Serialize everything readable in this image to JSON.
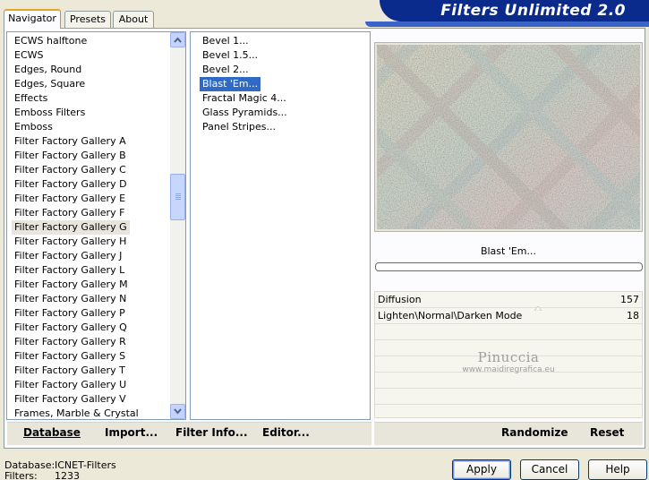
{
  "banner": {
    "title": "Filters Unlimited 2.0"
  },
  "tabs": [
    {
      "label": "Navigator",
      "active": true
    },
    {
      "label": "Presets",
      "active": false
    },
    {
      "label": "About",
      "active": false
    }
  ],
  "categories": {
    "items": [
      "ECWS halftone",
      "ECWS",
      "Edges, Round",
      "Edges, Square",
      "Effects",
      "Emboss Filters",
      "Emboss",
      "Filter Factory Gallery A",
      "Filter Factory Gallery B",
      "Filter Factory Gallery C",
      "Filter Factory Gallery D",
      "Filter Factory Gallery E",
      "Filter Factory Gallery F",
      "Filter Factory Gallery G",
      "Filter Factory Gallery H",
      "Filter Factory Gallery J",
      "Filter Factory Gallery L",
      "Filter Factory Gallery M",
      "Filter Factory Gallery N",
      "Filter Factory Gallery P",
      "Filter Factory Gallery Q",
      "Filter Factory Gallery R",
      "Filter Factory Gallery S",
      "Filter Factory Gallery T",
      "Filter Factory Gallery U",
      "Filter Factory Gallery V",
      "Frames, Marble & Crystal"
    ],
    "selected_index": 13
  },
  "filters": {
    "items": [
      "Bevel 1...",
      "Bevel 1.5...",
      "Bevel 2...",
      "Blast 'Em...",
      "Fractal Magic 4...",
      "Glass Pyramids...",
      "Panel Stripes..."
    ],
    "selected_index": 3
  },
  "preview": {
    "filter_name": "Blast 'Em...",
    "progress": 0
  },
  "params": [
    {
      "name": "Diffusion",
      "value": "157"
    },
    {
      "name": "Lighten\\Normal\\Darken Mode",
      "value": "18"
    }
  ],
  "watermark": {
    "name": "Pinuccia",
    "url": "www.maidiregrafica.eu"
  },
  "actions": {
    "database": "Database",
    "import": "Import...",
    "filter_info": "Filter Info...",
    "editor": "Editor...",
    "randomize": "Randomize",
    "reset": "Reset"
  },
  "status": {
    "database_label": "Database:",
    "database_value": "ICNET-Filters",
    "filters_label": "Filters:",
    "filters_value": "1233"
  },
  "dialog": {
    "apply": "Apply",
    "cancel": "Cancel",
    "help": "Help"
  },
  "colors": {
    "banner": "#0a2a8c",
    "selection": "#316ac5",
    "panel_bg": "#ece9d8"
  }
}
